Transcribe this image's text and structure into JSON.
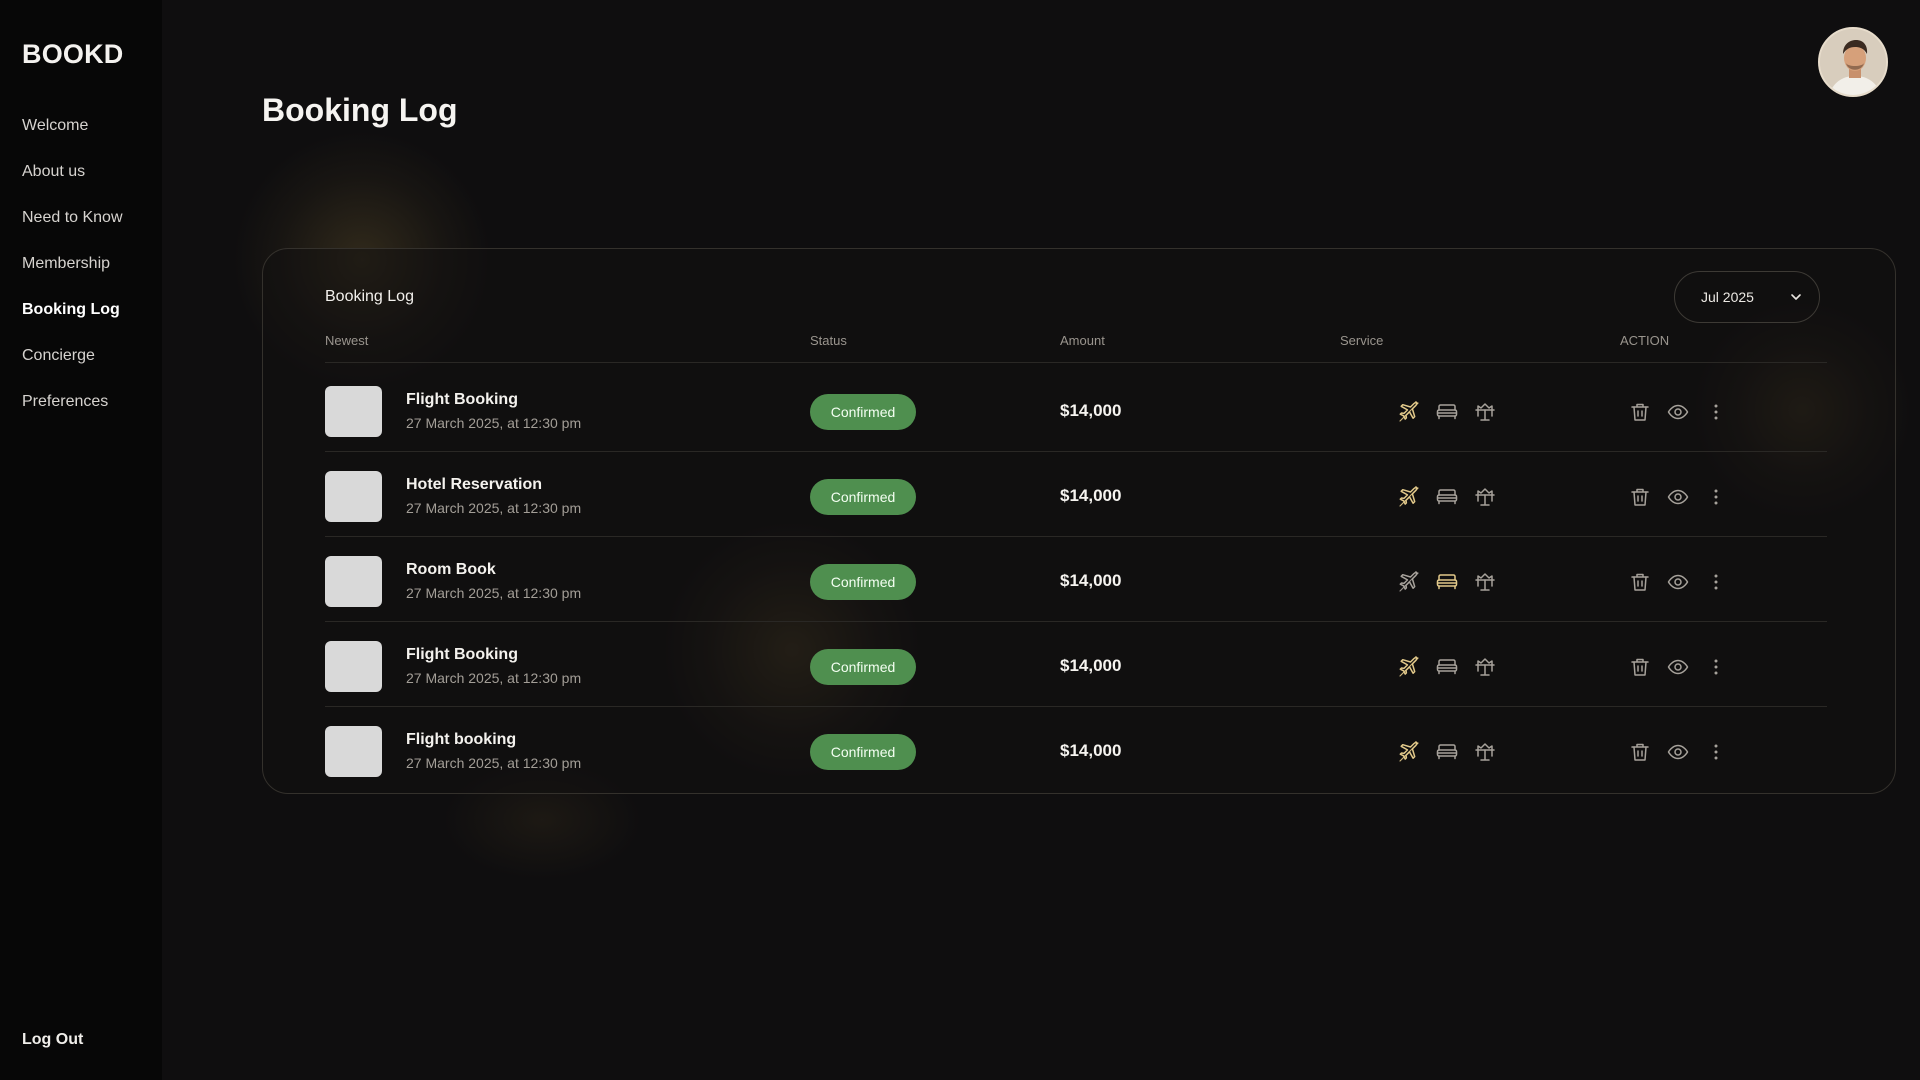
{
  "brand": "BOOKD",
  "nav": {
    "items": [
      "Welcome",
      "About us",
      "Need to Know",
      "Membership",
      "Booking Log",
      "Concierge",
      "Preferences"
    ],
    "logout": "Log Out"
  },
  "page": {
    "title": "Booking Log"
  },
  "card": {
    "title": "Booking Log",
    "date_filter": "Jul 2025",
    "columns": [
      "Newest",
      "Status",
      "Amount",
      "Service",
      "ACTION"
    ]
  },
  "rows": [
    {
      "title": "Flight Booking",
      "date": "27 March 2025, at 12:30 pm",
      "status": "Confirmed",
      "amount": "$14,000",
      "active_service": "flight"
    },
    {
      "title": "Hotel Reservation",
      "date": "27 March 2025, at 12:30 pm",
      "status": "Confirmed",
      "amount": "$14,000",
      "active_service": "flight"
    },
    {
      "title": "Room Book",
      "date": "27 March 2025, at 12:30 pm",
      "status": "Confirmed",
      "amount": "$14,000",
      "active_service": "bed"
    },
    {
      "title": "Flight Booking",
      "date": "27 March 2025, at 12:30 pm",
      "status": "Confirmed",
      "amount": "$14,000",
      "active_service": "flight"
    },
    {
      "title": "Flight booking",
      "date": "27 March 2025, at 12:30 pm",
      "status": "Confirmed",
      "amount": "$14,000",
      "active_service": "flight"
    }
  ],
  "icons": {
    "services": [
      "airplane-icon",
      "bed-icon",
      "concierge-icon"
    ],
    "actions": [
      "trash-icon",
      "eye-icon",
      "more-vertical-icon"
    ]
  },
  "colors": {
    "accent_gold": "#e2c98a",
    "status_green": "#4f8f4f",
    "icon_muted": "#a7a29b"
  }
}
